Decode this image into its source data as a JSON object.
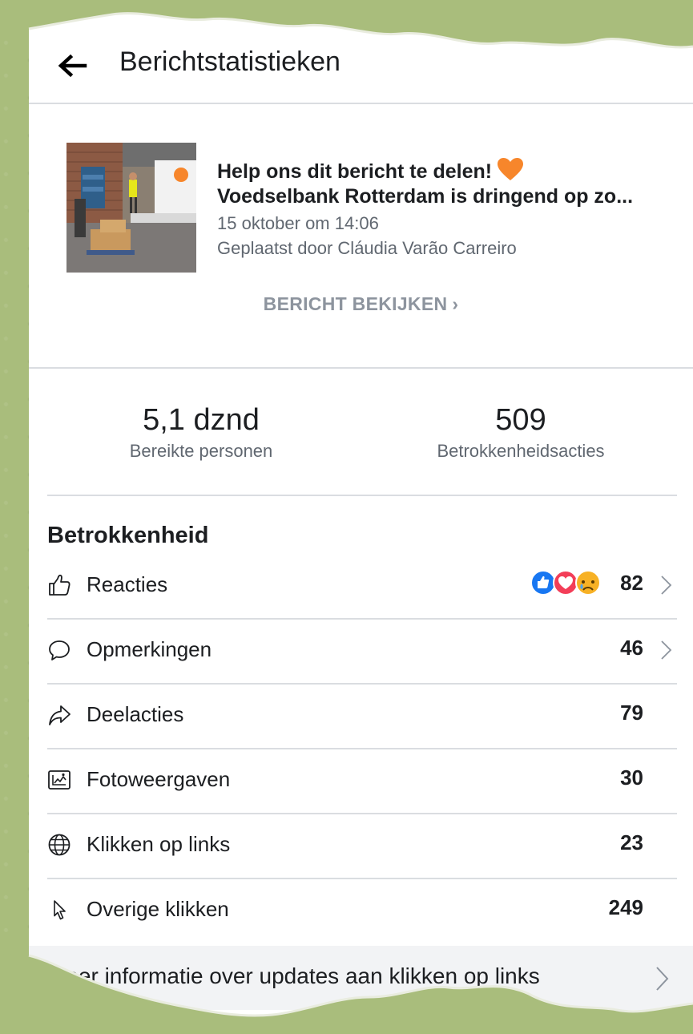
{
  "header": {
    "title": "Berichtstatistieken"
  },
  "post": {
    "title_line1": "Help ons dit bericht te delen!",
    "title_line2": "Voedselbank Rotterdam is dringend op zo...",
    "date": "15 oktober om 14:06",
    "author": "Geplaatst door Cláudia Varão Carreiro",
    "view_label": "BERICHT BEKIJKEN",
    "view_chevron": "›"
  },
  "stats": {
    "reach_value": "5,1 dznd",
    "reach_label": "Bereikte personen",
    "engagement_value": "509",
    "engagement_label": "Betrokkenheidsacties"
  },
  "engagement": {
    "title": "Betrokkenheid",
    "rows": [
      {
        "label": "Reacties",
        "value": "82",
        "icon": "thumbs-up-icon"
      },
      {
        "label": "Opmerkingen",
        "value": "46",
        "icon": "comment-icon"
      },
      {
        "label": "Deelacties",
        "value": "79",
        "icon": "share-icon"
      },
      {
        "label": "Fotoweergaven",
        "value": "30",
        "icon": "photo-icon"
      },
      {
        "label": "Klikken op links",
        "value": "23",
        "icon": "globe-icon"
      },
      {
        "label": "Overige klikken",
        "value": "249",
        "icon": "cursor-icon"
      }
    ]
  },
  "more_info": {
    "label": "Meer informatie over updates aan klikken op links"
  },
  "colors": {
    "background_green": "#a9bd7c",
    "like_blue": "#1877f2",
    "love_red": "#f33e58",
    "sad_yellow": "#f7b125",
    "heart_orange": "#f7862b",
    "muted_text": "#606770"
  }
}
